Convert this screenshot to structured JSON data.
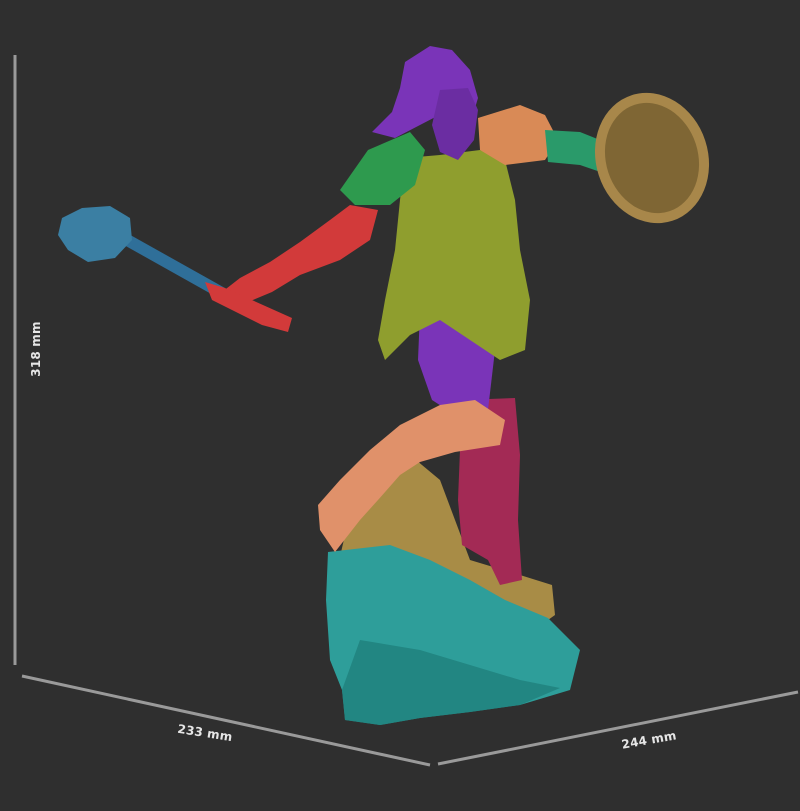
{
  "dimensions": {
    "height": "318 mm",
    "width": "233 mm",
    "depth": "244 mm"
  },
  "colors": {
    "background": "#2f2f2f",
    "dimension_line": "#9a9a9a",
    "dimension_text": "#e6e6e6",
    "hair_skin": "#7a34b8",
    "armor_torso": "#8f9e2e",
    "shoulder_left": "#2e9a4e",
    "shoulder_right": "#d98a56",
    "arm_mace": "#d23a3a",
    "arm_shield": "#2a9a6a",
    "mace_head": "#3b7fa3",
    "shield": "#a8874a",
    "leg_front": "#e0916a",
    "leg_back": "#a32a55",
    "rock_teal": "#2e9e9a",
    "rock_sand": "#a88c46"
  }
}
